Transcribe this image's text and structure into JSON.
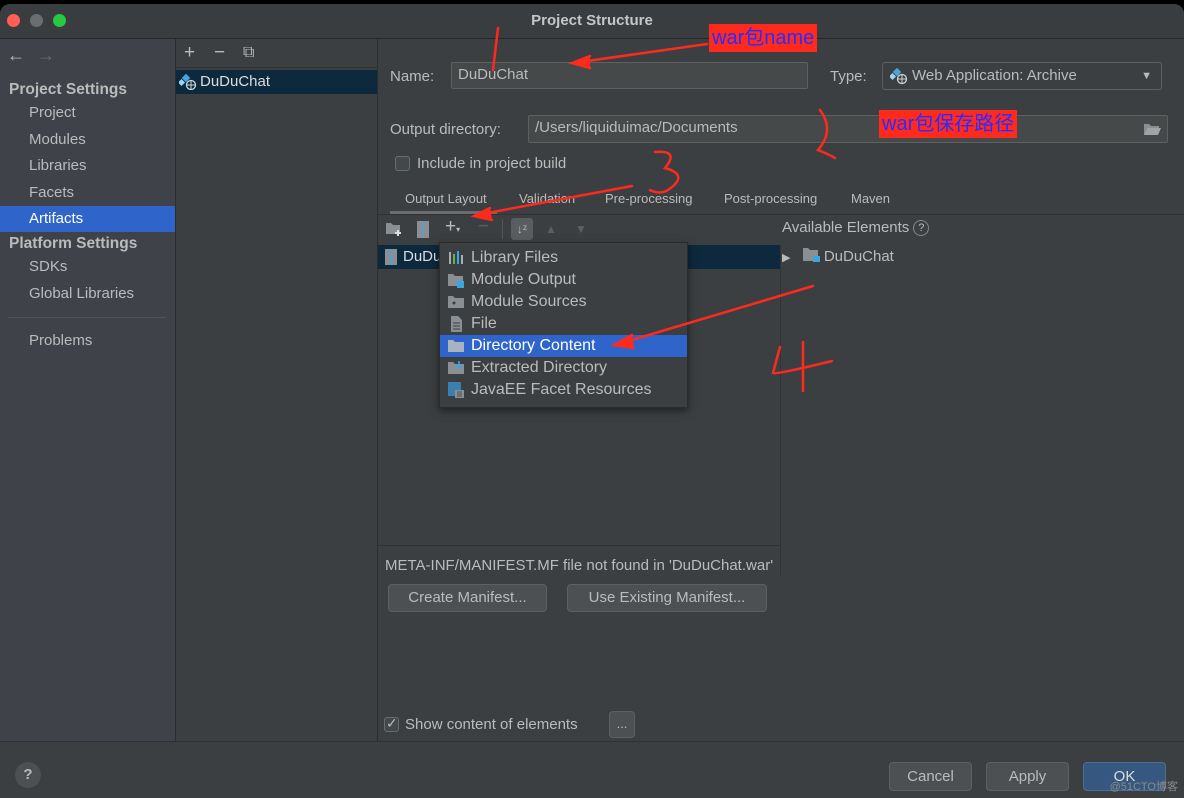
{
  "window": {
    "title": "Project Structure"
  },
  "sidebar": {
    "nav": {
      "back_icon": "arrow-left-icon",
      "forward_icon": "arrow-right-icon"
    },
    "project_settings_header": "Project Settings",
    "project_items": [
      {
        "label": "Project",
        "selected": false
      },
      {
        "label": "Modules",
        "selected": false
      },
      {
        "label": "Libraries",
        "selected": false
      },
      {
        "label": "Facets",
        "selected": false
      },
      {
        "label": "Artifacts",
        "selected": true
      }
    ],
    "platform_settings_header": "Platform Settings",
    "platform_items": [
      {
        "label": "SDKs"
      },
      {
        "label": "Global Libraries"
      }
    ],
    "problems_label": "Problems"
  },
  "artifact_list": {
    "toolbar": {
      "add_icon": "plus-icon",
      "remove_icon": "minus-icon",
      "copy_icon": "copy-icon"
    },
    "items": [
      {
        "label": "DuDuChat",
        "icon": "web-app-icon",
        "selected": true
      }
    ]
  },
  "form": {
    "name_label": "Name:",
    "name_value": "DuDuChat",
    "type_label": "Type:",
    "type_value": "Web Application: Archive",
    "output_dir_label": "Output directory:",
    "output_dir_value": "/Users/liquiduimac/Documents",
    "include_build_label": "Include in project build",
    "include_build_checked": false
  },
  "tabs": [
    {
      "label": "Output Layout",
      "active": true
    },
    {
      "label": "Validation",
      "active": false
    },
    {
      "label": "Pre-processing",
      "active": false
    },
    {
      "label": "Post-processing",
      "active": false
    },
    {
      "label": "Maven",
      "active": false
    }
  ],
  "layout_toolbar": {
    "icons": [
      "new-folder-icon",
      "archive-icon",
      "add-copy-icon",
      "remove-icon",
      "sort-icon",
      "move-up-icon",
      "move-down-icon"
    ]
  },
  "layout_tree": {
    "root_label": "DuDuChat.war"
  },
  "available": {
    "header": "Available Elements",
    "help_glyph": "?",
    "items": [
      {
        "label": "DuDuChat",
        "expand_glyph": "▶"
      }
    ]
  },
  "add_menu": {
    "items": [
      {
        "label": "Library Files",
        "icon": "library-icon",
        "selected": false
      },
      {
        "label": "Module Output",
        "icon": "module-output-icon",
        "selected": false
      },
      {
        "label": "Module Sources",
        "icon": "module-sources-icon",
        "selected": false
      },
      {
        "label": "File",
        "icon": "file-icon",
        "selected": false
      },
      {
        "label": "Directory Content",
        "icon": "folder-icon",
        "selected": true
      },
      {
        "label": "Extracted Directory",
        "icon": "extracted-dir-icon",
        "selected": false
      },
      {
        "label": "JavaEE Facet Resources",
        "icon": "javaee-resources-icon",
        "selected": false
      }
    ]
  },
  "manifest": {
    "message": "META-INF/MANIFEST.MF file not found in 'DuDuChat.war'",
    "create_button": "Create Manifest...",
    "use_existing_button": "Use Existing Manifest..."
  },
  "show_content": {
    "label": "Show content of elements",
    "checked": true,
    "more_button": "..."
  },
  "footer": {
    "help_glyph": "?",
    "cancel": "Cancel",
    "apply": "Apply",
    "ok": "OK"
  },
  "annotations": {
    "war_name": "war包name",
    "war_path": "war包保存路径",
    "color": "#fe2a1e"
  },
  "watermark": "@51CTO博客"
}
